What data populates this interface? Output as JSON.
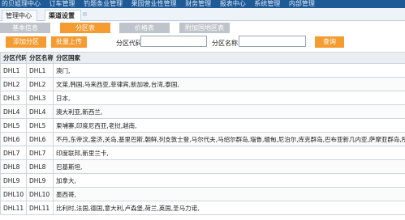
{
  "top_nav": [
    "的贝姐理中心",
    "订车管理",
    "钓题条业管理",
    "果园营业性管理",
    "财务管理",
    "报表中心",
    "系统管理",
    "内部管理"
  ],
  "tabs": {
    "items": [
      "管理中心",
      "渠道设置"
    ],
    "active_index": 1
  },
  "sub_tabs": {
    "items": [
      "基本信息",
      "分区表",
      "价格表",
      "附加国地区表"
    ],
    "active_index": 1
  },
  "toolbar": {
    "add_label": "添加分区",
    "batch_label": "批量上传",
    "code_label": "分区代码:",
    "code_value": "",
    "name_label": "分区名称:",
    "name_value": "",
    "query_label": "查询"
  },
  "table": {
    "headers": [
      "分区代码",
      "分区名称",
      "分区国家"
    ],
    "rows": [
      [
        "DHL1",
        "DHL1",
        "澳门,"
      ],
      [
        "DHL2",
        "DHL2",
        "文莱,韩国,马来西亚,菲律宾,新加坡,台湾,泰国,"
      ],
      [
        "DHL3",
        "DHL3",
        "日本,"
      ],
      [
        "DHL4",
        "DHL4",
        "澳大利亚,新西兰,"
      ],
      [
        "DHL5",
        "DHL5",
        "柬埔寨,印度尼西亚,老挝,越南,"
      ],
      [
        "DHL6",
        "DHL6",
        "不丹,东帝汶,斐济,关岛,基里巴斯,朝鲜,列支敦士登,马尔代夫,马绍尔群岛,瑙鲁,缅甸,尼泊尔,库克群岛,巴布亚新几内亚,萨摩亚群岛,所罗门群岛,汤加,"
      ],
      [
        "DHL7",
        "DHL7",
        "印度联邦,新里兰卡,"
      ],
      [
        "DHL8",
        "DHL8",
        "巴基斯坦,"
      ],
      [
        "DHL9",
        "DHL9",
        "加拿大,"
      ],
      [
        "DHL10",
        "DHL10",
        "墨西哥,"
      ],
      [
        "DHL11",
        "DHL11",
        "比利时,法国,德国,意大利,卢森堡,荷兰,英国,圣马力诺,"
      ]
    ]
  }
}
